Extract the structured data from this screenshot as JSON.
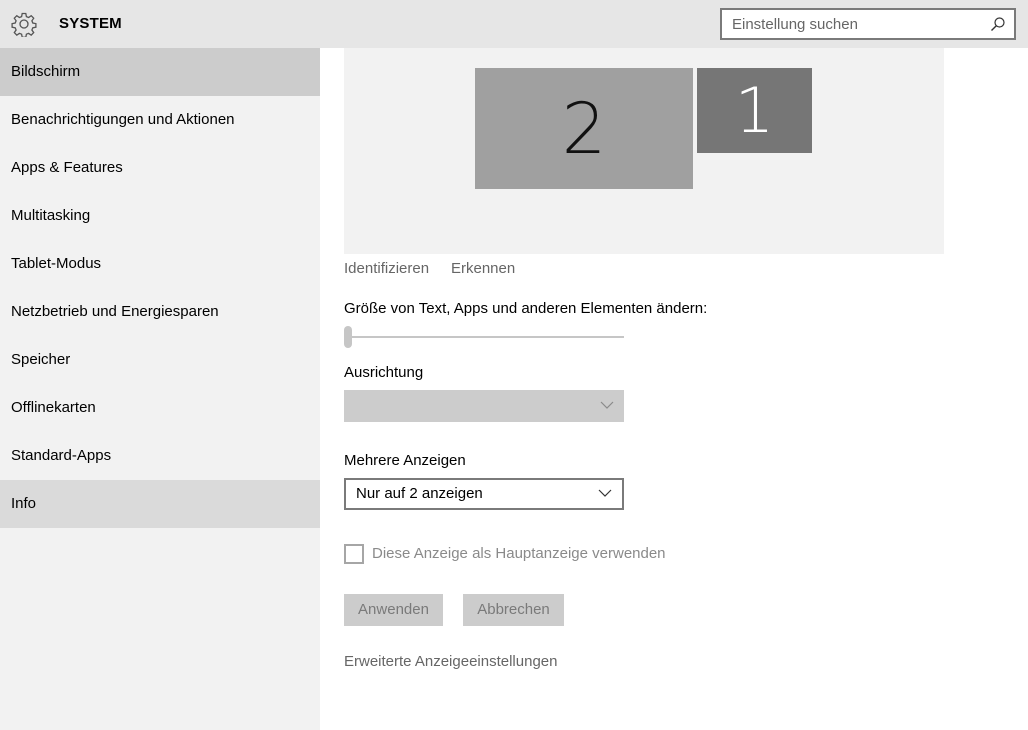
{
  "header": {
    "title": "SYSTEM",
    "search_placeholder": "Einstellung suchen",
    "icons": [
      "gear-icon",
      "search-icon"
    ]
  },
  "sidebar": {
    "items": [
      {
        "label": "Bildschirm",
        "state": "selected"
      },
      {
        "label": "Benachrichtigungen und Aktionen",
        "state": "normal"
      },
      {
        "label": "Apps & Features",
        "state": "normal"
      },
      {
        "label": "Multitasking",
        "state": "normal"
      },
      {
        "label": "Tablet-Modus",
        "state": "normal"
      },
      {
        "label": "Netzbetrieb und Energiesparen",
        "state": "normal"
      },
      {
        "label": "Speicher",
        "state": "normal"
      },
      {
        "label": "Offlinekarten",
        "state": "normal"
      },
      {
        "label": "Standard-Apps",
        "state": "normal"
      },
      {
        "label": "Info",
        "state": "hover"
      }
    ]
  },
  "main": {
    "monitors": [
      {
        "number": "2",
        "color": "#a0a0a0"
      },
      {
        "number": "1",
        "color": "#767676"
      }
    ],
    "identify_label": "Identifizieren",
    "detect_label": "Erkennen",
    "scale_label": "Größe von Text, Apps und anderen Elementen ändern:",
    "scale_value_percent": 0,
    "orientation_label": "Ausrichtung",
    "orientation_value": "",
    "multiple_displays_label": "Mehrere Anzeigen",
    "multiple_displays_value": "Nur auf 2 anzeigen",
    "main_display_checkbox_label": "Diese Anzeige als Hauptanzeige verwenden",
    "main_display_checked": false,
    "apply_label": "Anwenden",
    "cancel_label": "Abbrechen",
    "advanced_link": "Erweiterte Anzeigeeinstellungen"
  },
  "colors": {
    "header_bg": "#e6e6e6",
    "sidebar_bg": "#f2f2f2",
    "selected_bg": "#cccccc",
    "preview_bg": "#f2f2f2"
  }
}
